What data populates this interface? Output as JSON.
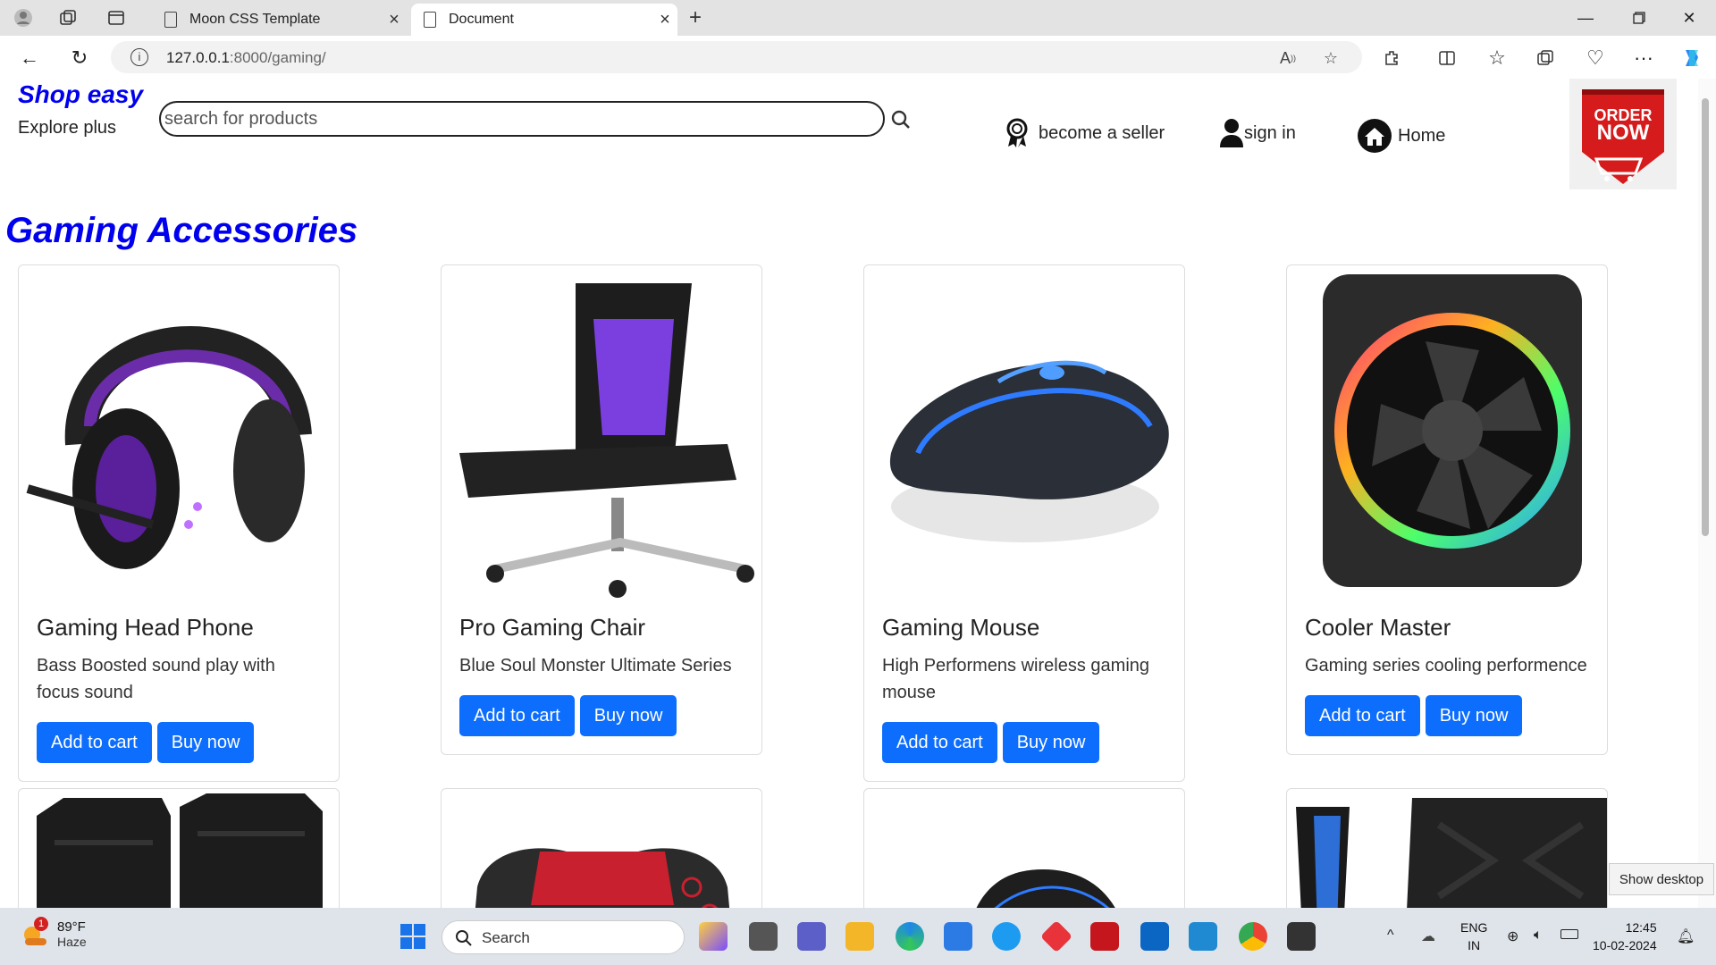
{
  "browser": {
    "tabs": [
      {
        "title": "Moon CSS Template"
      },
      {
        "title": "Document"
      }
    ],
    "url_host": "127.0.0.1",
    "url_path": ":8000/gaming/"
  },
  "header": {
    "brand": "Shop easy",
    "subbrand": "Explore plus",
    "search_placeholder": "search for products",
    "links": {
      "seller": "become a seller",
      "signin": "sign in",
      "home": "Home"
    },
    "badge_line1": "ORDER",
    "badge_line2": "NOW"
  },
  "section_title": "Gaming Accessories",
  "products": [
    {
      "title": "Gaming Head Phone",
      "desc": "Bass Boosted sound play with focus sound",
      "add": "Add to cart",
      "buy": "Buy now"
    },
    {
      "title": "Pro Gaming Chair",
      "desc": "Blue Soul Monster Ultimate Series",
      "add": "Add to cart",
      "buy": "Buy now"
    },
    {
      "title": "Gaming Mouse",
      "desc": "High Performens wireless gaming mouse",
      "add": "Add to cart",
      "buy": "Buy now"
    },
    {
      "title": "Cooler Master",
      "desc": "Gaming series cooling performence",
      "add": "Add to cart",
      "buy": "Buy now"
    }
  ],
  "tooltip": "Show desktop",
  "taskbar": {
    "weather_badge": "1",
    "weather_temp": "89°F",
    "weather_desc": "Haze",
    "search": "Search",
    "lang1": "ENG",
    "lang2": "IN",
    "time": "12:45",
    "date": "10-02-2024"
  }
}
